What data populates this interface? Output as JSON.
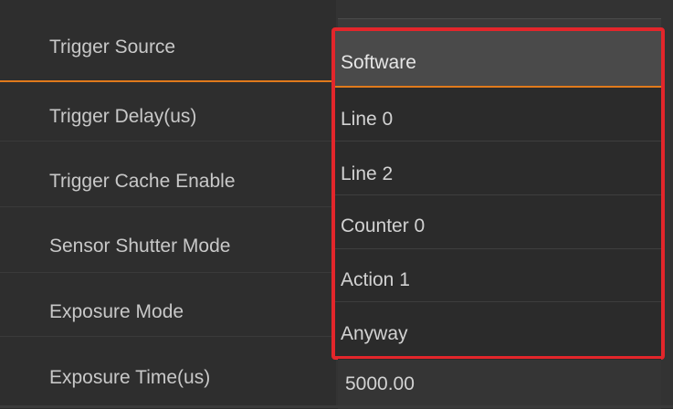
{
  "properties": {
    "labels": [
      "Trigger Source",
      "Trigger Delay(us)",
      "Trigger Cache Enable",
      "Sensor Shutter Mode",
      "Exposure Mode",
      "Exposure Time(us)"
    ],
    "exposure_time_value": "5000.00"
  },
  "dropdown": {
    "selected": "Software",
    "options": [
      "Software",
      "Line 0",
      "Line 2",
      "Counter 0",
      "Action 1",
      "Anyway"
    ]
  },
  "colors": {
    "highlight_border": "#e3262b",
    "accent": "#e07a1c",
    "background": "#2c2c2c",
    "text": "#c8c8c8"
  }
}
